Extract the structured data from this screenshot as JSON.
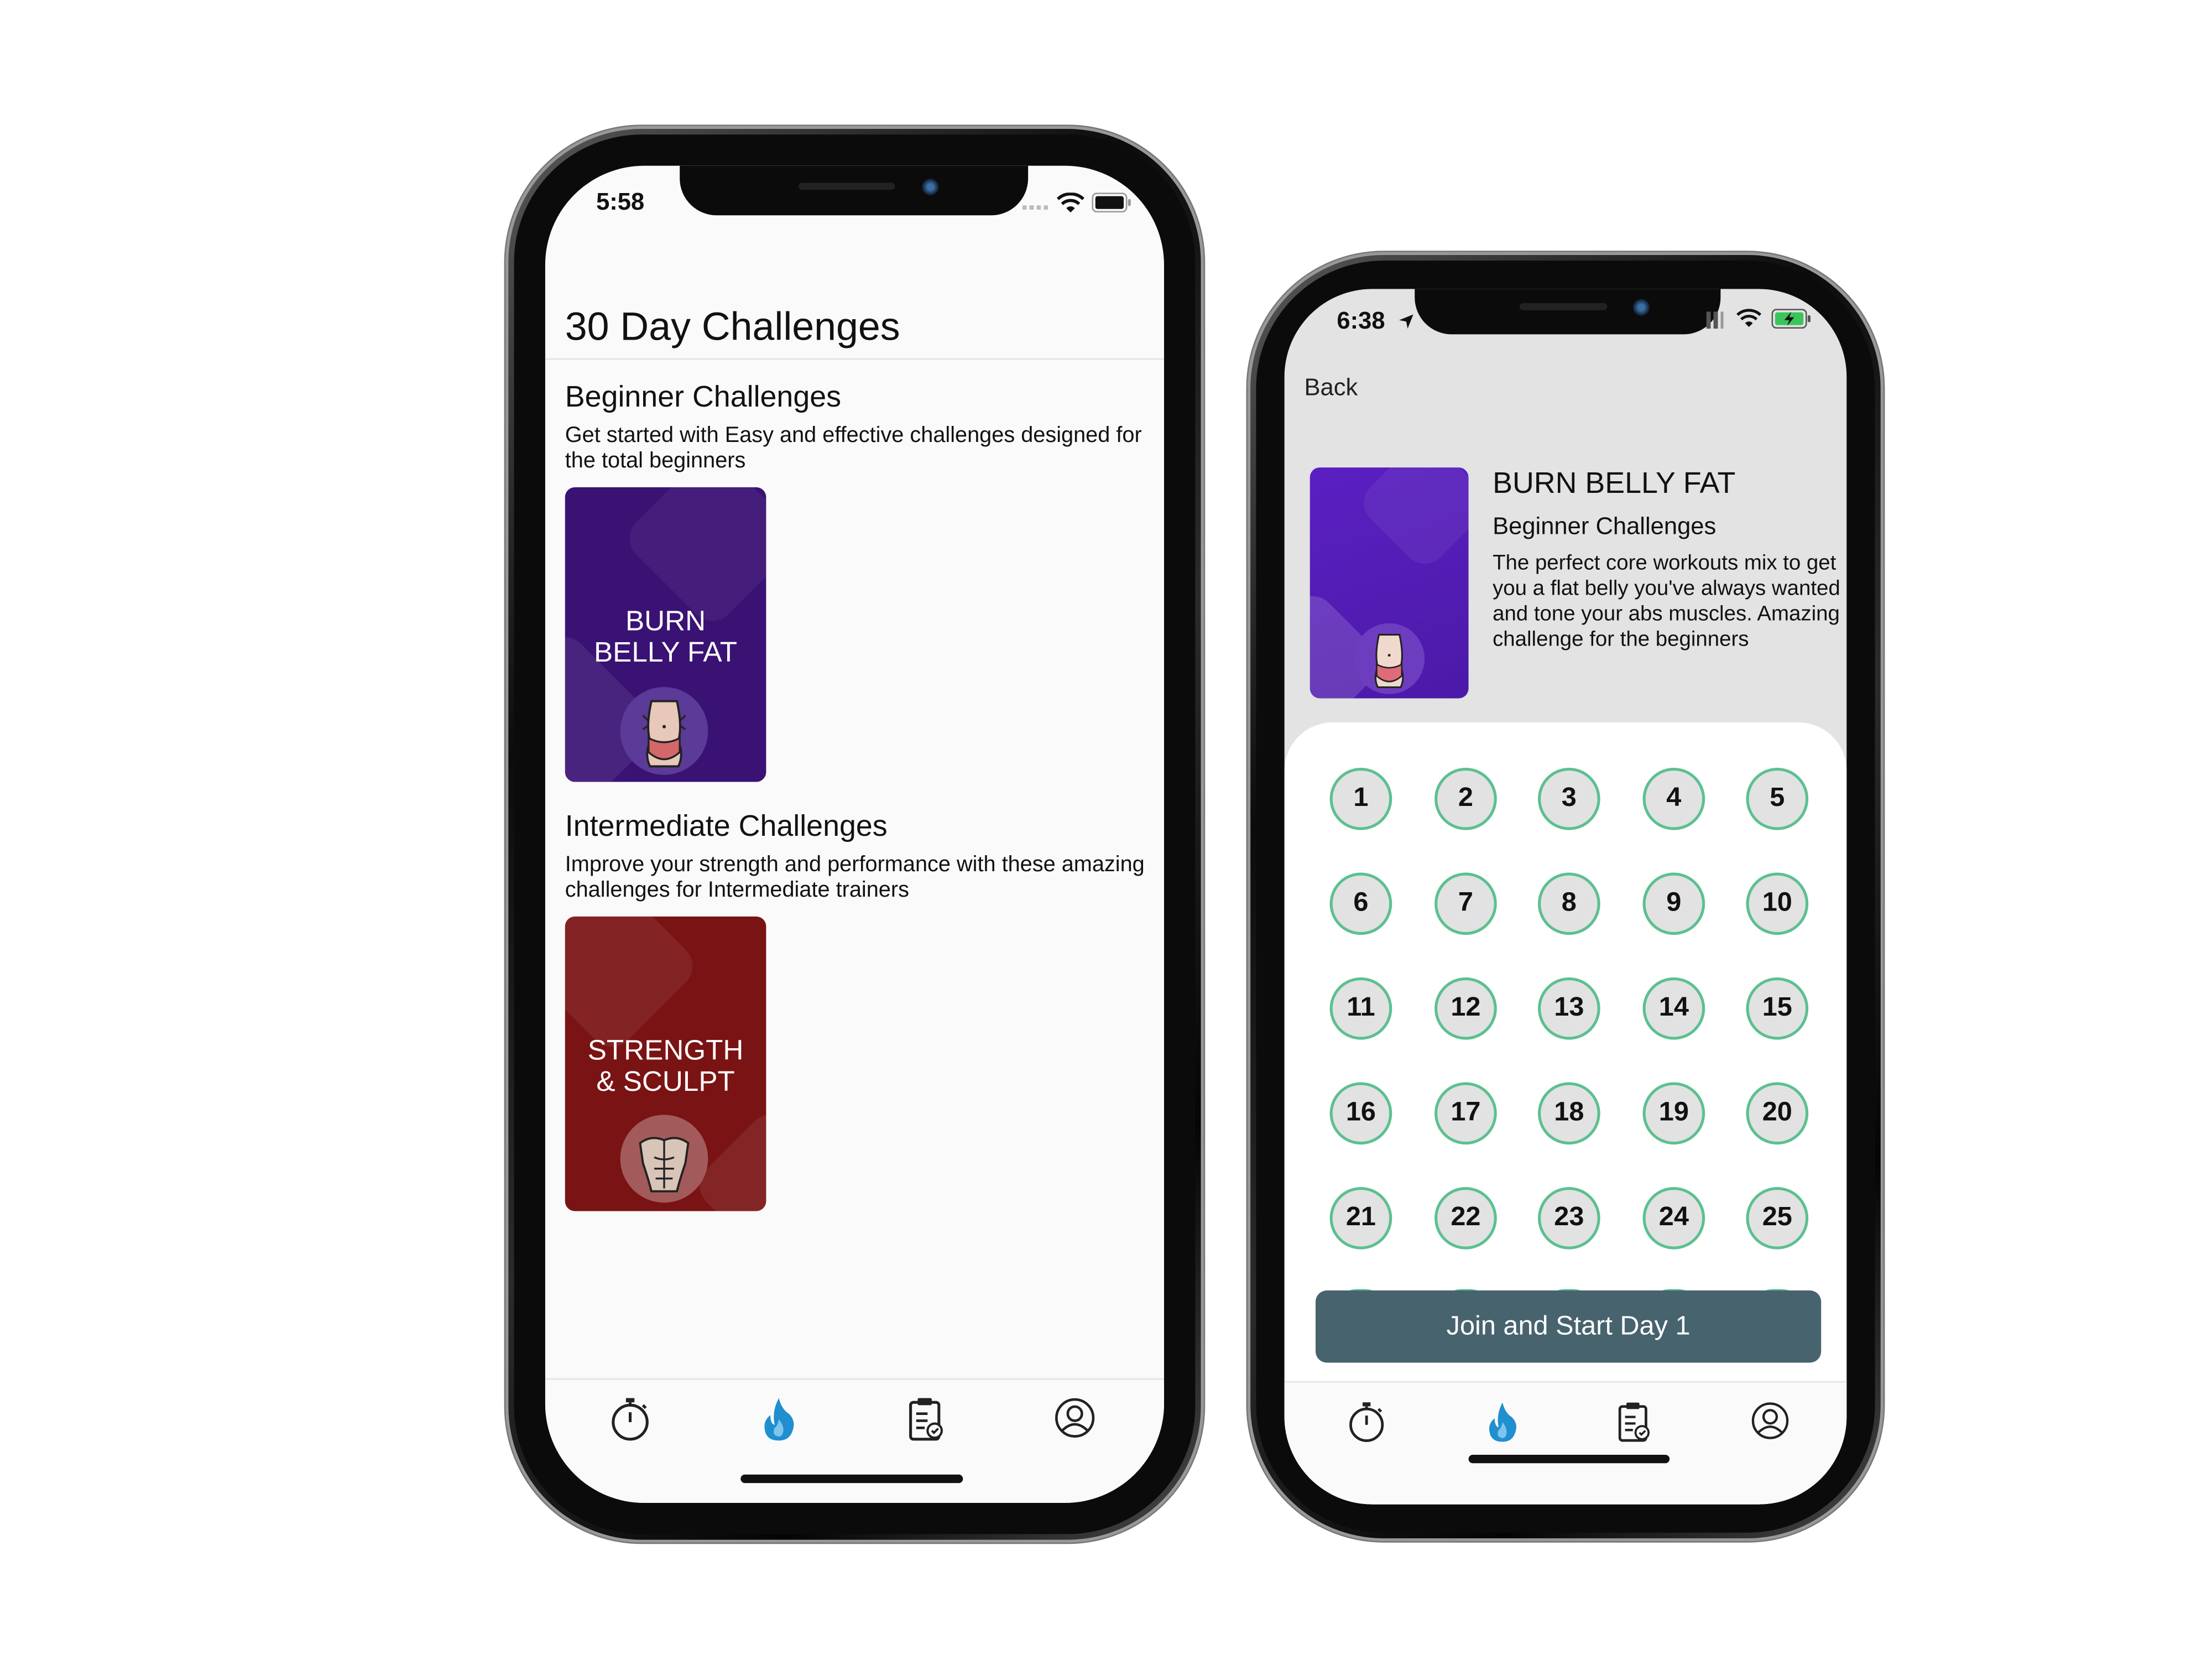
{
  "phone1": {
    "status_time": "5:58",
    "page_title": "30 Day Challenges",
    "sections": [
      {
        "title": "Beginner Challenges",
        "description": "Get started with Easy and effective challenges designed for the total beginners",
        "card_label_line1": "BURN",
        "card_label_line2": "BELLY FAT",
        "card_color": "#3a1273",
        "card_icon": "belly-icon"
      },
      {
        "title": "Intermediate Challenges",
        "description": "Improve your strength and performance with these amazing challenges for Intermediate trainers",
        "card_label_line1": "STRENGTH",
        "card_label_line2": "& SCULPT",
        "card_color": "#7a1313",
        "card_icon": "torso-icon"
      }
    ],
    "tabs": [
      {
        "icon": "stopwatch-icon"
      },
      {
        "icon": "flame-icon",
        "active": true
      },
      {
        "icon": "clipboard-icon"
      },
      {
        "icon": "profile-icon"
      }
    ]
  },
  "phone2": {
    "status_time": "6:38",
    "back_label": "Back",
    "challenge_title": "BURN BELLY FAT",
    "challenge_level": "Beginner Challenges",
    "challenge_description": "The perfect core workouts mix to get you a flat belly you've always wanted and tone your abs muscles. Amazing challenge for the beginners",
    "days": [
      "1",
      "2",
      "3",
      "4",
      "5",
      "6",
      "7",
      "8",
      "9",
      "10",
      "11",
      "12",
      "13",
      "14",
      "15",
      "16",
      "17",
      "18",
      "19",
      "20",
      "21",
      "22",
      "23",
      "24",
      "25"
    ],
    "join_button": "Join and Start Day 1",
    "tabs": [
      {
        "icon": "stopwatch-icon"
      },
      {
        "icon": "flame-icon",
        "active": true
      },
      {
        "icon": "clipboard-icon"
      },
      {
        "icon": "profile-icon"
      }
    ]
  },
  "colors": {
    "active_tab": "#1f8fd0",
    "day_ring": "#5cc08f",
    "join_button": "#47636e",
    "beginner_card": "#3a1273",
    "intermediate_card": "#7a1313"
  }
}
